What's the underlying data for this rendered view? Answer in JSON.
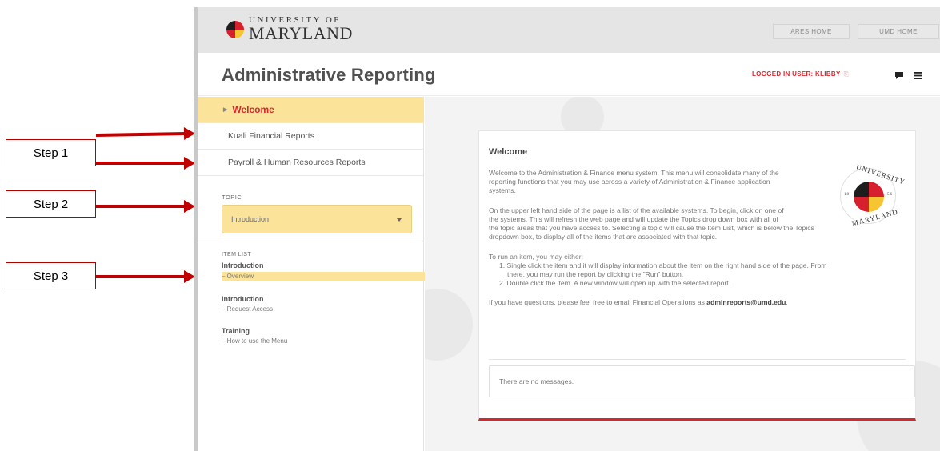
{
  "steps": {
    "step1": "Step 1",
    "step2": "Step 2",
    "step3": "Step 3"
  },
  "header": {
    "logo_small": "UNIVERSITY OF",
    "logo_big": "MARYLAND",
    "ares_home": "ARES HOME",
    "umd_home": "UMD HOME",
    "page_title": "Administrative Reporting",
    "logged_in": "LOGGED IN USER: KLIBBY"
  },
  "sidebar": {
    "systems": [
      {
        "label": "Welcome"
      },
      {
        "label": "Kuali Financial Reports"
      },
      {
        "label": "Payroll & Human Resources Reports"
      }
    ],
    "topic_label": "TOPIC",
    "topic_value": "Introduction",
    "item_list_label": "ITEM LIST",
    "items": [
      {
        "title": "Introduction",
        "sub": "– Overview"
      },
      {
        "title": "Introduction",
        "sub": "– Request Access"
      },
      {
        "title": "Training",
        "sub": "– How to use the Menu"
      }
    ]
  },
  "content": {
    "title": "Welcome",
    "p1": [
      "Welcome to the Administration & Finance menu system. This menu will consolidate many of the",
      "reporting functions that you may use across a variety of Administration & Finance application",
      "systems."
    ],
    "p2": [
      "On the upper left hand side of the page is a list of the available systems. To begin, click on one of",
      "the systems. This will refresh the web page and will update the Topics drop down box with all of",
      "the topic areas that you have access to. Selecting a topic will cause the Item List, which is below the Topics",
      "dropdown box, to display all of the items that are associated with that topic."
    ],
    "p3": "To run an item, you may either:",
    "li1": [
      "1. Single click the item and it will display information about the item on the right hand side of the page. From",
      "there, you may run the report by clicking the \"Run\" button."
    ],
    "li2": "2. Double click the item. A new window will open up with the selected report.",
    "p4_pre": "If you have questions, please feel free to email Financial Operations as ",
    "p4_email": "adminreports@umd.edu",
    "p4_post": ".",
    "messages": "There are no messages.",
    "seal_top": "UNIVERSITY",
    "seal_bottom": "MARYLAND",
    "seal_left": "18",
    "seal_right": "56"
  }
}
